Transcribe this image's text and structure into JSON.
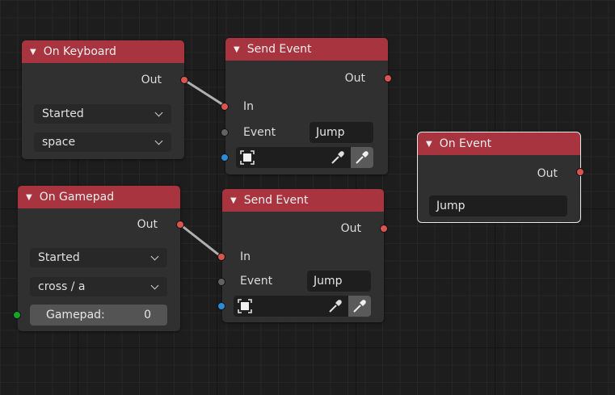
{
  "nodes": {
    "on_keyboard": {
      "title": "On Keyboard",
      "output_label": "Out",
      "trigger_mode": "Started",
      "key": "space"
    },
    "send_event_1": {
      "title": "Send Event",
      "output_label": "Out",
      "input_label": "In",
      "event_label": "Event",
      "event_value": "Jump"
    },
    "on_event": {
      "title": "On Event",
      "output_label": "Out",
      "event_value": "Jump"
    },
    "on_gamepad": {
      "title": "On Gamepad",
      "output_label": "Out",
      "trigger_mode": "Started",
      "button": "cross / a",
      "gamepad_label": "Gamepad:",
      "gamepad_index": "0"
    },
    "send_event_2": {
      "title": "Send Event",
      "output_label": "Out",
      "input_label": "In",
      "event_label": "Event",
      "event_value": "Jump"
    }
  },
  "colors": {
    "header": "#a8343f",
    "node_body": "#303030",
    "socket_flow": "#d9534f",
    "socket_string": "#626262",
    "socket_object": "#2a8cd8",
    "socket_int": "#15a629",
    "link": "#b0b0b0"
  }
}
